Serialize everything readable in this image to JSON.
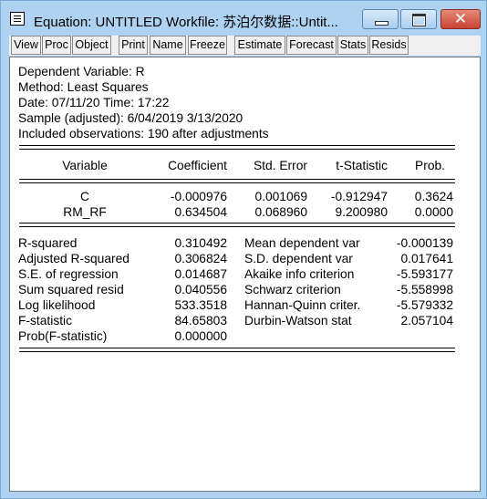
{
  "window": {
    "title": "Equation: UNTITLED   Workfile: 苏泊尔数据::Untit..."
  },
  "toolbar": [
    {
      "label": "View"
    },
    {
      "label": "Proc"
    },
    {
      "label": "Object"
    },
    {
      "label": "Print"
    },
    {
      "label": "Name"
    },
    {
      "label": "Freeze"
    },
    {
      "label": "Estimate"
    },
    {
      "label": "Forecast"
    },
    {
      "label": "Stats"
    },
    {
      "label": "Resids"
    }
  ],
  "header": {
    "dependent": "Dependent Variable: R",
    "method": "Method: Least Squares",
    "datetime": "Date: 07/11/20   Time: 17:22",
    "sample": "Sample (adjusted): 6/04/2019 3/13/2020",
    "observations": "Included observations: 190 after adjustments"
  },
  "columns": {
    "variable": "Variable",
    "coefficient": "Coefficient",
    "std_error": "Std. Error",
    "t_statistic": "t-Statistic",
    "prob": "Prob."
  },
  "coefficients": [
    {
      "variable": "C",
      "coefficient": "-0.000976",
      "std_error": "0.001069",
      "t_statistic": "-0.912947",
      "prob": "0.3624"
    },
    {
      "variable": "RM_RF",
      "coefficient": "0.634504",
      "std_error": "0.068960",
      "t_statistic": "9.200980",
      "prob": "0.0000"
    }
  ],
  "stats_left": [
    {
      "label": "R-squared",
      "value": "0.310492"
    },
    {
      "label": "Adjusted R-squared",
      "value": "0.306824"
    },
    {
      "label": "S.E. of regression",
      "value": "0.014687"
    },
    {
      "label": "Sum squared resid",
      "value": "0.040556"
    },
    {
      "label": "Log likelihood",
      "value": "533.3518"
    },
    {
      "label": "F-statistic",
      "value": "84.65803"
    },
    {
      "label": "Prob(F-statistic)",
      "value": "0.000000"
    }
  ],
  "stats_right": [
    {
      "label": "Mean dependent var",
      "value": "-0.000139"
    },
    {
      "label": "S.D. dependent var",
      "value": "0.017641"
    },
    {
      "label": "Akaike info criterion",
      "value": "-5.593177"
    },
    {
      "label": "Schwarz criterion",
      "value": "-5.558998"
    },
    {
      "label": "Hannan-Quinn criter.",
      "value": "-5.579332"
    },
    {
      "label": "Durbin-Watson stat",
      "value": "2.057104"
    }
  ],
  "colors": {
    "titlebar": "#aed2f0",
    "close_button": "#c84332"
  },
  "icons": [
    "equation-icon",
    "minimize-icon",
    "maximize-icon",
    "close-icon"
  ]
}
